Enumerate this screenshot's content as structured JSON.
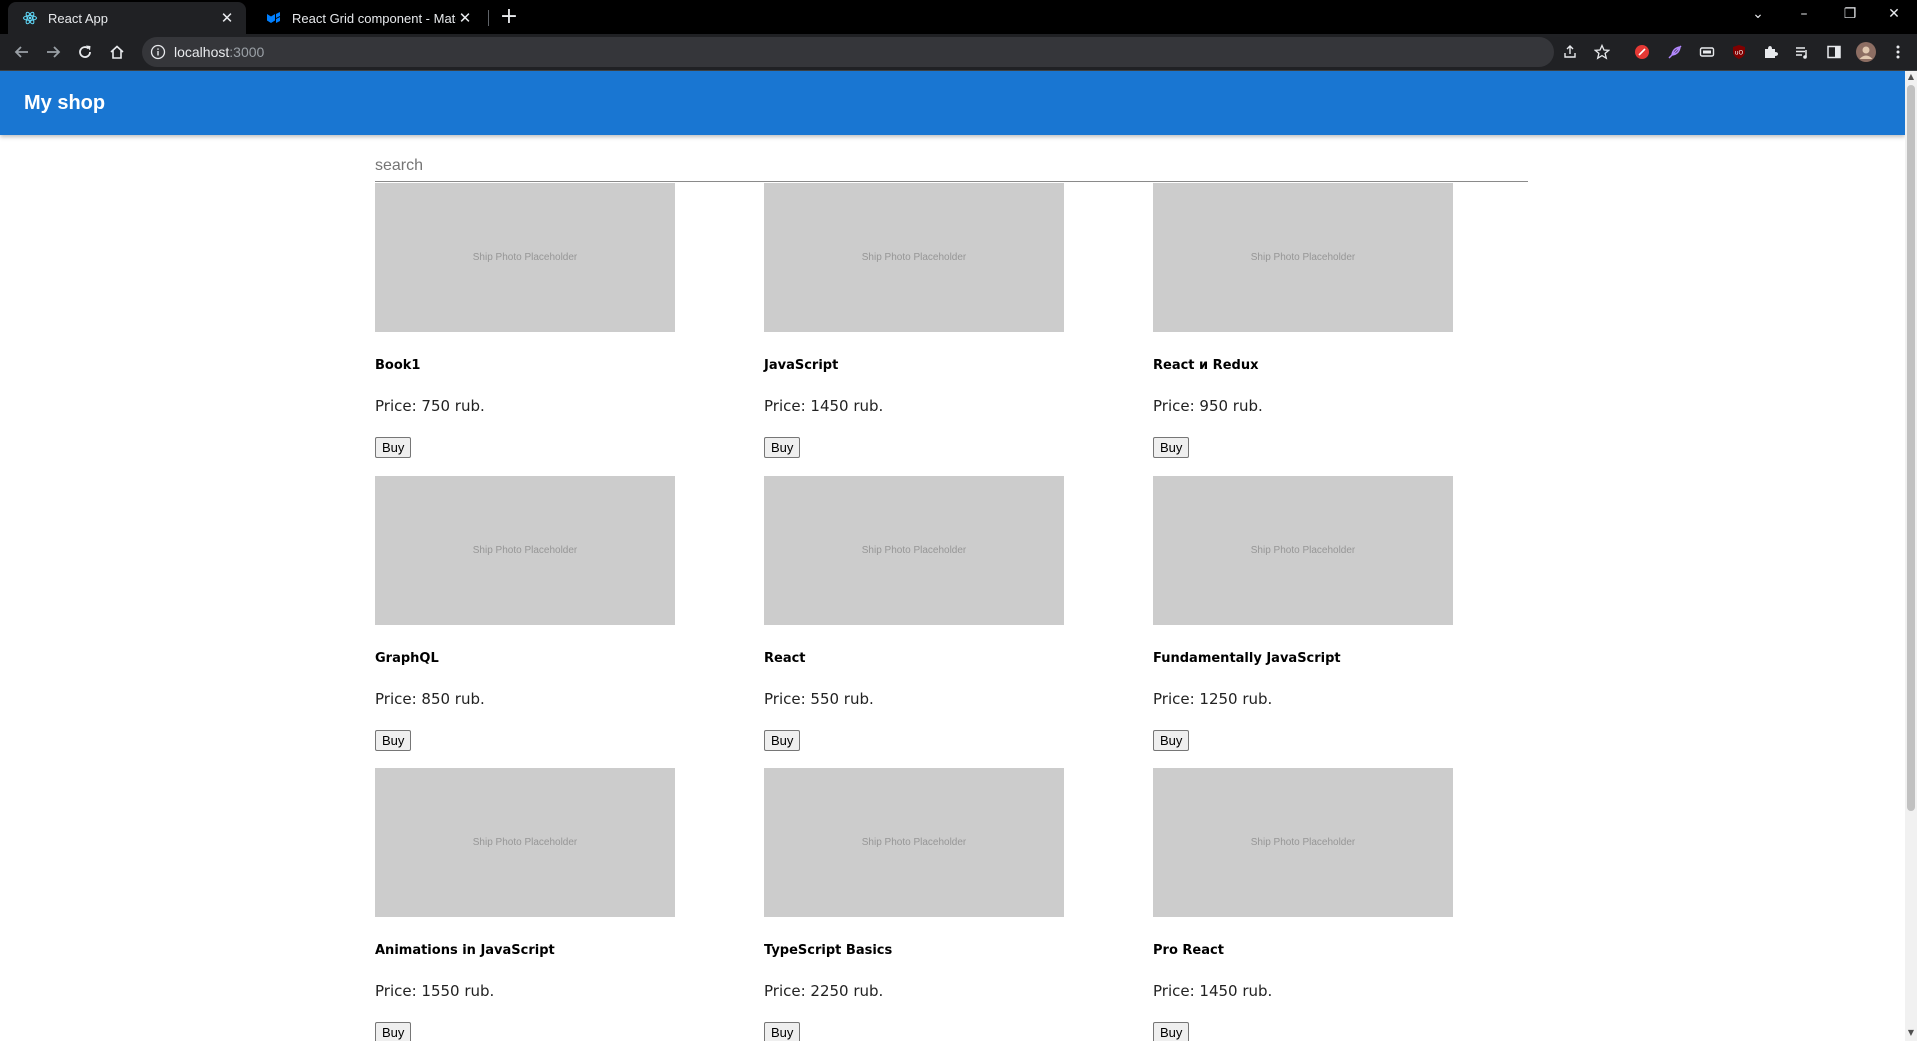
{
  "browser": {
    "tabs": [
      {
        "title": "React App",
        "active": true
      },
      {
        "title": "React Grid component - Material",
        "active": false
      }
    ],
    "new_tab": "+",
    "window_controls": {
      "dropdown": "⌄",
      "minimize": "–",
      "restore": "❐",
      "close": "✕"
    },
    "url_host": "localhost",
    "url_port": ":3000"
  },
  "app": {
    "brand": "My shop",
    "search_placeholder": "search",
    "buy_label": "Buy",
    "placeholder_text": "Ship Photo Placeholder",
    "products": [
      {
        "title": "Book1",
        "price": "Price: 750 rub."
      },
      {
        "title": "JavaScript",
        "price": "Price: 1450 rub."
      },
      {
        "title": "React и Redux",
        "price": "Price: 950 rub."
      },
      {
        "title": "GraphQL",
        "price": "Price: 850 rub."
      },
      {
        "title": "React",
        "price": "Price: 550 rub."
      },
      {
        "title": "Fundamentally JavaScript",
        "price": "Price: 1250 rub."
      },
      {
        "title": "Animations in JavaScript",
        "price": "Price: 1550 rub."
      },
      {
        "title": "TypeScript Basics",
        "price": "Price: 2250 rub."
      },
      {
        "title": "Pro React",
        "price": "Price: 1450 rub."
      }
    ]
  },
  "colors": {
    "appbar": "#1976d2",
    "photo_placeholder": "#cccccc",
    "tabbar": "#000000",
    "toolbar": "#202124"
  }
}
